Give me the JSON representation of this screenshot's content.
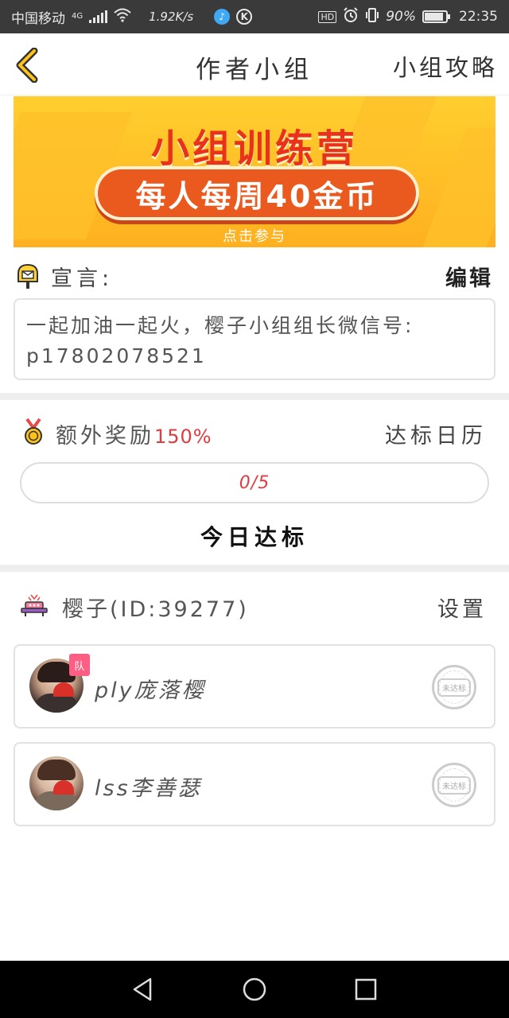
{
  "status_bar": {
    "carrier": "中国移动",
    "network": "4G",
    "speed": "1.92K/s",
    "hd": "HD",
    "battery": "90%",
    "battery_level": 0.9,
    "time": "22:35",
    "app_k": "K"
  },
  "header": {
    "title": "作者小组",
    "guide": "小组攻略",
    "back_icon": "chevron-left-icon"
  },
  "banner": {
    "title": "小组训练营",
    "subtitle": "每人每周40金币",
    "cta": "点击参与"
  },
  "manifesto": {
    "label": "宣言:",
    "edit": "编辑",
    "text": "一起加油一起火，樱子小组组长微信号: p17802078521"
  },
  "reward": {
    "label": "额外奖励",
    "percent": "150%",
    "calendar": "达标日历",
    "progress_text": "0/5",
    "progress_value": 0,
    "progress_max": 5,
    "today": "今日达标"
  },
  "group": {
    "name": "樱子(ID:39277)",
    "settings": "设置",
    "members": [
      {
        "name": "ply庞落樱",
        "badge": "队",
        "status": "未达标"
      },
      {
        "name": "lss李善瑟",
        "badge": "",
        "status": "未达标"
      }
    ]
  },
  "colors": {
    "accent": "#ffb020",
    "highlight_red": "#e03b40",
    "banner_red": "#e8321c"
  }
}
